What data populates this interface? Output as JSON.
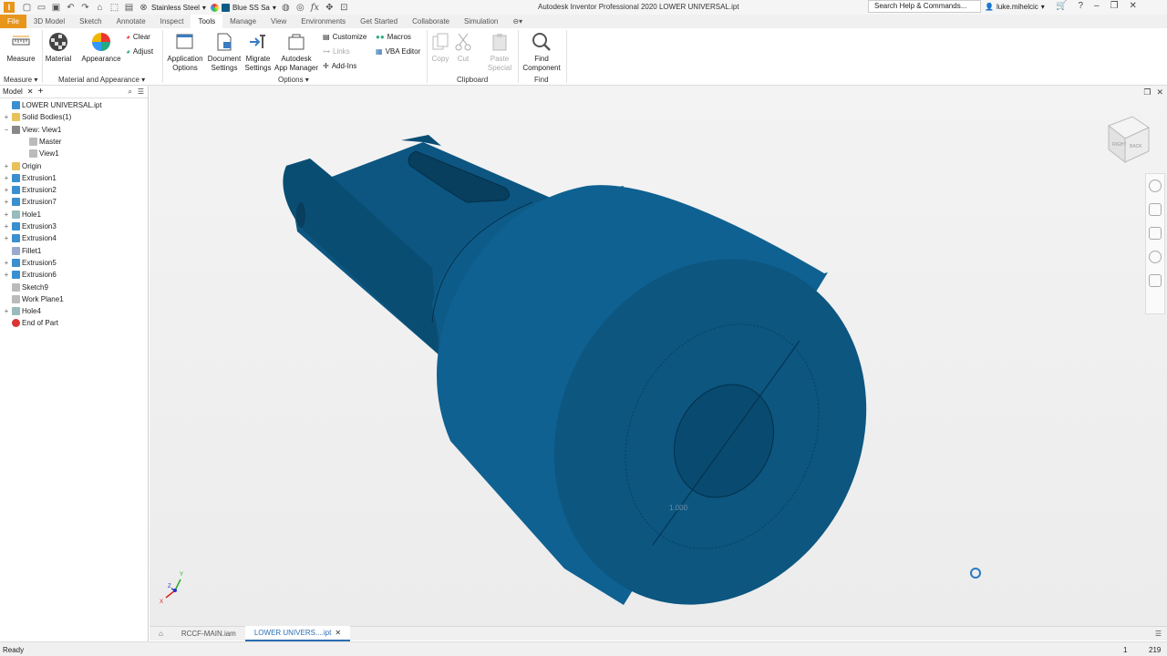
{
  "titlebar": {
    "app_title": "Autodesk Inventor Professional 2020   LOWER UNIVERSAL.ipt",
    "material": "Stainless Steel",
    "appearance": "Blue SS Sa",
    "search_placeholder": "Search Help & Commands...",
    "user": "luke.mihelcic",
    "icons": [
      "inventor-logo",
      "new-icon",
      "open-icon",
      "save-icon",
      "undo-icon",
      "redo-icon",
      "home-icon",
      "select-icon",
      "update-icon",
      "material-icon",
      "appearance-icon",
      "clear-icon",
      "adjust-icon",
      "fx-icon",
      "move-icon",
      "capture-icon",
      "user-icon",
      "cart-icon",
      "help-icon"
    ]
  },
  "tabs": [
    "File",
    "3D Model",
    "Sketch",
    "Annotate",
    "Inspect",
    "Tools",
    "Manage",
    "View",
    "Environments",
    "Get Started",
    "Collaborate",
    "Simulation"
  ],
  "active_tab": "Tools",
  "ribbon": {
    "measure": {
      "label": "Measure",
      "panel": "Measure"
    },
    "material_appearance": {
      "material": "Material",
      "appearance": "Appearance",
      "clear": "Clear",
      "adjust": "Adjust",
      "panel": "Material and Appearance"
    },
    "options": {
      "app_options_l1": "Application",
      "app_options_l2": "Options",
      "doc_settings_l1": "Document",
      "doc_settings_l2": "Settings",
      "migrate_l1": "Migrate",
      "migrate_l2": "Settings",
      "app_manager_l1": "Autodesk",
      "app_manager_l2": "App Manager",
      "customize": "Customize",
      "links": "Links",
      "addins": "Add-Ins",
      "macros": "Macros",
      "vba": "VBA Editor",
      "panel": "Options"
    },
    "clipboard": {
      "copy": "Copy",
      "cut": "Cut",
      "paste_l1": "Paste",
      "paste_l2": "Special",
      "panel": "Clipboard"
    },
    "find": {
      "find_l1": "Find",
      "find_l2": "Component",
      "panel": "Find"
    }
  },
  "browser": {
    "title": "Model",
    "items": [
      {
        "label": "LOWER UNIVERSAL.ipt",
        "icon": "part-icon",
        "expander": ""
      },
      {
        "label": "Solid Bodies(1)",
        "icon": "folder-icon",
        "expander": "+"
      },
      {
        "label": "View: View1",
        "icon": "view-icon",
        "expander": "−"
      },
      {
        "label": "Master",
        "icon": "lock-icon",
        "expander": ""
      },
      {
        "label": "View1",
        "icon": "view-check-icon",
        "expander": ""
      },
      {
        "label": "Origin",
        "icon": "folder-icon",
        "expander": "+"
      },
      {
        "label": "Extrusion1",
        "icon": "extrusion-icon",
        "expander": "+"
      },
      {
        "label": "Extrusion2",
        "icon": "extrusion-icon",
        "expander": "+"
      },
      {
        "label": "Extrusion7",
        "icon": "extrusion-icon",
        "expander": "+"
      },
      {
        "label": "Hole1",
        "icon": "hole-icon",
        "expander": "+"
      },
      {
        "label": "Extrusion3",
        "icon": "extrusion-icon",
        "expander": "+"
      },
      {
        "label": "Extrusion4",
        "icon": "extrusion-icon",
        "expander": "+"
      },
      {
        "label": "Fillet1",
        "icon": "fillet-icon",
        "expander": ""
      },
      {
        "label": "Extrusion5",
        "icon": "extrusion-icon",
        "expander": "+"
      },
      {
        "label": "Extrusion6",
        "icon": "extrusion-icon",
        "expander": "+"
      },
      {
        "label": "Sketch9",
        "icon": "sketch-icon",
        "expander": ""
      },
      {
        "label": "Work Plane1",
        "icon": "workplane-icon",
        "expander": ""
      },
      {
        "label": "Hole4",
        "icon": "hole-icon",
        "expander": "+"
      },
      {
        "label": "End of Part",
        "icon": "end-of-part-icon",
        "expander": ""
      }
    ]
  },
  "viewport": {
    "dimension_label": "1.000",
    "viewcube_labels": [
      "RIGHT",
      "BACK"
    ],
    "triad_labels": {
      "x": "X",
      "y": "Y",
      "z": "Z"
    },
    "part_color": "#0e5a86"
  },
  "doc_tabs": [
    {
      "label": "RCCF-MAIN.iam",
      "active": false
    },
    {
      "label": "LOWER UNIVERS....ipt",
      "active": true
    }
  ],
  "status": {
    "text": "Ready",
    "count_a": "1",
    "count_b": "219"
  },
  "colors": {
    "file_tab": "#e8951c",
    "accent": "#2a6fb3",
    "part": "#0e5a86"
  }
}
